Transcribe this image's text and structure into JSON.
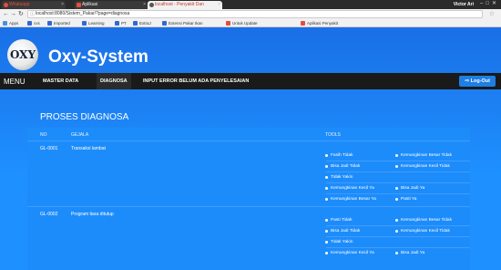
{
  "browser": {
    "tabs": [
      {
        "label": "Whatsapp",
        "color": "#e74c3c"
      },
      {
        "label": "Aplikasi",
        "color": "#e74c3c"
      },
      {
        "label": "localhost - Penyakit Dan",
        "color": "#c0392b"
      }
    ],
    "user": "Victor Ari",
    "url": "localhost:8080/Sistem_Pakar/?page=diagnosa",
    "bookmarks": [
      "Apps",
      "cvs",
      "Imported",
      "Learning",
      "PT",
      "ExtraJ",
      "Extensi Pakar Ikan",
      "Untuk Update",
      "Aplikasi Penyakit"
    ]
  },
  "app": {
    "logo_text": "OXY",
    "title": "Oxy-System"
  },
  "navbar": {
    "menu_label": "MENU",
    "items": [
      "MASTER DATA",
      "DIAGNOSA",
      "INPUT ERROR BELUM ADA PENYELESAIAN"
    ],
    "logout_label": "Log-Out"
  },
  "page": {
    "title": "PROSES DIAGNOSA",
    "columns": [
      "NO",
      "GEJALA",
      "TOOLS"
    ],
    "rows": [
      {
        "no": "GL-0001",
        "gejala": "Transaksi lambat",
        "tools": [
          [
            "Fasih Tidak",
            "Kemungkinan Besar Tidak"
          ],
          [
            "Bisa Jadi Tidak",
            "Kemungkinan Kecil Tidak"
          ],
          [
            "Tidak Yakin",
            ""
          ],
          [
            "Kemungkinan Kecil Ya",
            "Bisa Jadi Ya"
          ],
          [
            "Kemungkinan Besar Ya",
            "Pasti Ya"
          ]
        ]
      },
      {
        "no": "GL-0002",
        "gejala": "Program tiara ditutup",
        "tools": [
          [
            "Pasti Tidak",
            "Kemungkinan Besar Tidak"
          ],
          [
            "Bisa Jadi Tidak",
            "Kemungkinan Kecil Tidak"
          ],
          [
            "Tidak Yakin",
            ""
          ],
          [
            "Kemungkinan Kecil Ya",
            "Bisa Jadi Ya"
          ]
        ]
      }
    ]
  }
}
